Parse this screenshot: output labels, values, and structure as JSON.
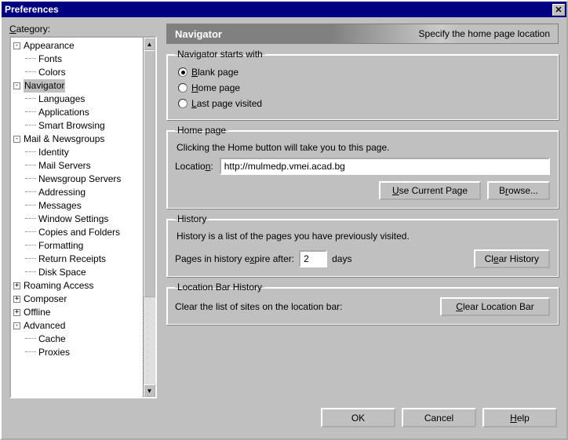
{
  "window": {
    "title": "Preferences",
    "close_glyph": "✕"
  },
  "category_label_pre": "C",
  "category_label_post": "ategory:",
  "tree": [
    {
      "type": "parent",
      "exp": "-",
      "label": "Appearance"
    },
    {
      "type": "child",
      "label": "Fonts"
    },
    {
      "type": "child",
      "label": "Colors"
    },
    {
      "type": "parent",
      "exp": "-",
      "label": "Navigator",
      "selected": true
    },
    {
      "type": "child",
      "label": "Languages"
    },
    {
      "type": "child",
      "label": "Applications"
    },
    {
      "type": "child",
      "label": "Smart Browsing"
    },
    {
      "type": "parent",
      "exp": "-",
      "label": "Mail & Newsgroups"
    },
    {
      "type": "child",
      "label": "Identity"
    },
    {
      "type": "child",
      "label": "Mail Servers"
    },
    {
      "type": "child",
      "label": "Newsgroup Servers"
    },
    {
      "type": "child",
      "label": "Addressing"
    },
    {
      "type": "child",
      "label": "Messages"
    },
    {
      "type": "child",
      "label": "Window Settings"
    },
    {
      "type": "child",
      "label": "Copies and Folders"
    },
    {
      "type": "child",
      "label": "Formatting"
    },
    {
      "type": "child",
      "label": "Return Receipts"
    },
    {
      "type": "child",
      "label": "Disk Space"
    },
    {
      "type": "parent",
      "exp": "+",
      "label": "Roaming Access"
    },
    {
      "type": "parent",
      "exp": "+",
      "label": "Composer"
    },
    {
      "type": "parent",
      "exp": "+",
      "label": "Offline"
    },
    {
      "type": "parent",
      "exp": "-",
      "label": "Advanced"
    },
    {
      "type": "child",
      "label": "Cache"
    },
    {
      "type": "child",
      "label": "Proxies"
    }
  ],
  "header": {
    "title": "Navigator",
    "desc": "Specify the home page location"
  },
  "starts_with": {
    "legend": "Navigator starts with",
    "options": [
      {
        "pre": "",
        "u": "B",
        "post": "lank page",
        "checked": true
      },
      {
        "pre": "",
        "u": "H",
        "post": "ome page",
        "checked": false
      },
      {
        "pre": "",
        "u": "L",
        "post": "ast page visited",
        "checked": false
      }
    ]
  },
  "home_page": {
    "legend": "Home page",
    "desc": "Clicking the Home button will take you to this page.",
    "location_pre": "Locatio",
    "location_u": "n",
    "location_post": ":",
    "value": "http://mulmedp.vmei.acad.bg",
    "use_current_pre": "",
    "use_current_u": "U",
    "use_current_post": "se Current Page",
    "browse_pre": "B",
    "browse_u": "r",
    "browse_post": "owse..."
  },
  "history": {
    "legend": "History",
    "desc": "History is a list of the pages you have previously visited.",
    "expire_pre": "Pages in history e",
    "expire_u": "x",
    "expire_post": "pire after:",
    "days_value": "2",
    "days_label": "days",
    "clear_pre": "Cl",
    "clear_u": "e",
    "clear_post": "ar History"
  },
  "locbar": {
    "legend": "Location Bar History",
    "desc": "Clear the list of sites on the location bar:",
    "clear_pre": "",
    "clear_u": "C",
    "clear_post": "lear Location Bar"
  },
  "footer": {
    "ok": "OK",
    "cancel": "Cancel",
    "help_pre": "",
    "help_u": "H",
    "help_post": "elp"
  },
  "scroll": {
    "up": "▲",
    "down": "▼"
  }
}
